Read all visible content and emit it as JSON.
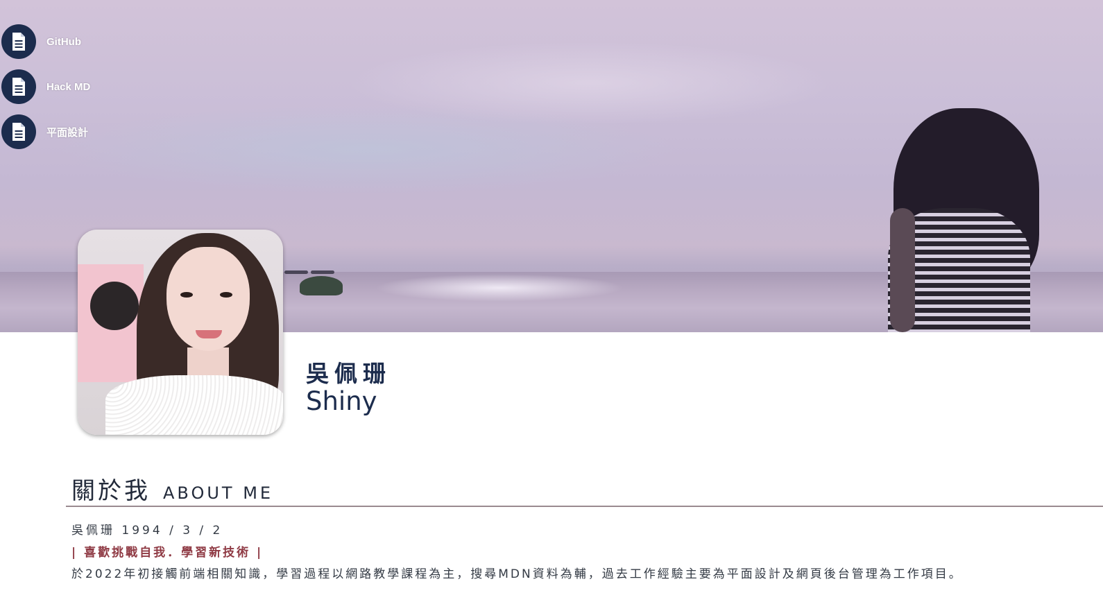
{
  "nav": {
    "items": [
      {
        "label": "GitHub",
        "icon": "document-icon"
      },
      {
        "label": "Hack MD",
        "icon": "document-icon"
      },
      {
        "label": "平面設計",
        "icon": "document-icon"
      }
    ]
  },
  "profile": {
    "name_zh": "吳佩珊",
    "name_en": "Shiny"
  },
  "about": {
    "title_zh": "關於我",
    "title_en": "ABOUT ME",
    "birth": "吳佩珊 1994 / 3 / 2",
    "motto": "| 喜歡挑戰自我．學習新技術 |",
    "description": "於2022年初接觸前端相關知識，學習過程以網路教學課程為主，搜尋MDN資料為輔，過去工作經驗主要為平面設計及網頁後台管理為工作項目。"
  },
  "colors": {
    "navy": "#1c2c4d",
    "motto": "#8f3a44",
    "divider": "#9a8a90"
  }
}
